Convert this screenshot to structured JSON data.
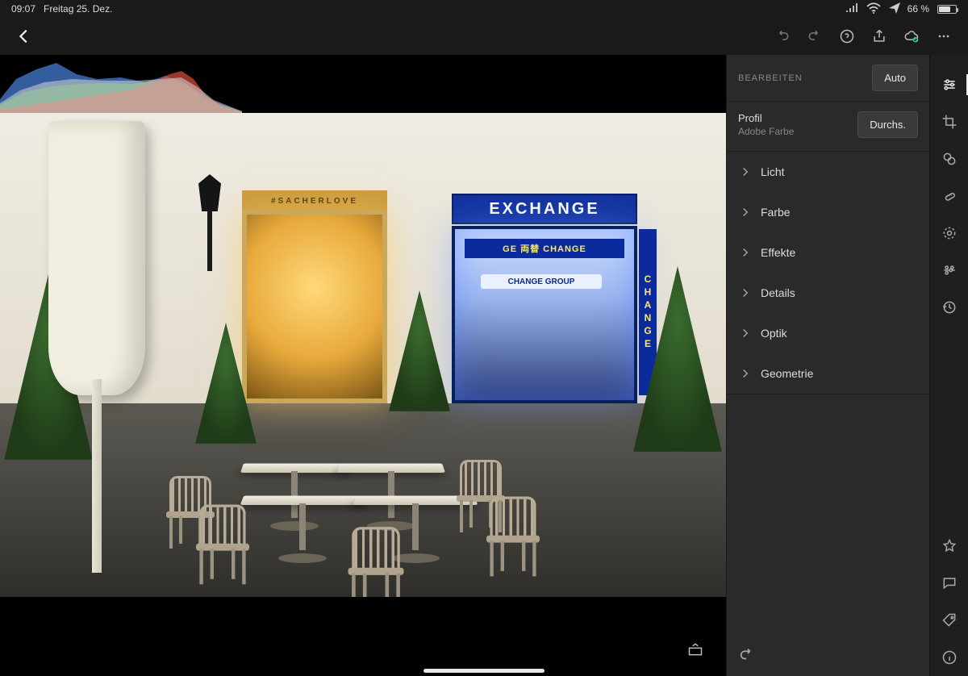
{
  "status": {
    "time": "09:07",
    "date": "Freitag 25. Dez.",
    "battery_pct": "66 %"
  },
  "toolbar": {
    "back": "Zurück"
  },
  "panel": {
    "title": "BEARBEITEN",
    "auto_label": "Auto",
    "profile_label": "Profil",
    "profile_value": "Adobe Farbe",
    "browse_label": "Durchs.",
    "sections": {
      "licht": "Licht",
      "farbe": "Farbe",
      "effekte": "Effekte",
      "details": "Details",
      "optik": "Optik",
      "geometrie": "Geometrie"
    }
  },
  "scene": {
    "exchange_sign": "EXCHANGE",
    "cafe_sign": "#SACHERLOVE",
    "exchange_inner": "GE 両替 CHANGE",
    "exchange_brand": "CHANGE GROUP",
    "exchange_vertical": "CHANGE"
  }
}
